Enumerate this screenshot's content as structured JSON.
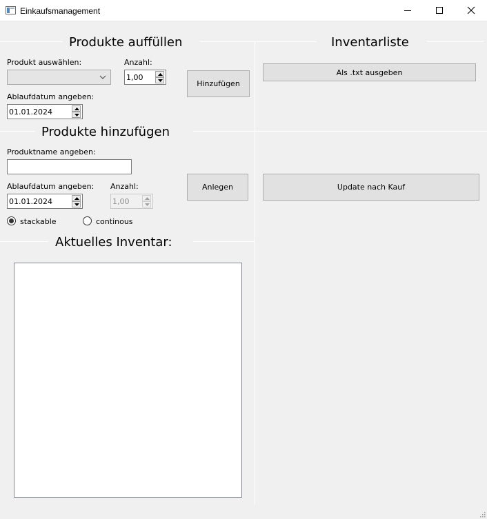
{
  "window": {
    "title": "Einkaufsmanagement"
  },
  "refill": {
    "title": "Produkte auffüllen",
    "product_label": "Produkt auswählen:",
    "product_value": "",
    "amount_label": "Anzahl:",
    "amount_value": "1,00",
    "date_label": "Ablaufdatum angeben:",
    "date_value": "01.01.2024",
    "add_button": "Hinzufügen"
  },
  "create": {
    "title": "Produkte hinzufügen",
    "name_label": "Produktname angeben:",
    "name_value": "",
    "date_label": "Ablaufdatum angeben:",
    "date_value": "01.01.2024",
    "amount_label": "Anzahl:",
    "amount_value": "1,00",
    "create_button": "Anlegen",
    "radio_stackable": "stackable",
    "radio_continuous": "continous",
    "selected_radio": "stackable"
  },
  "inventory": {
    "title": "Aktuelles Inventar:",
    "items": []
  },
  "inventory_list": {
    "title": "Inventarliste",
    "export_button": "Als .txt ausgeben",
    "update_button": "Update nach Kauf"
  },
  "icons": {
    "app": "app-window-icon",
    "minimize": "minimize-icon",
    "maximize": "maximize-icon",
    "close": "close-icon",
    "dropdown": "chevron-down-icon",
    "spin_up": "spin-up-icon",
    "spin_down": "spin-down-icon",
    "resize": "resize-grip-icon"
  }
}
